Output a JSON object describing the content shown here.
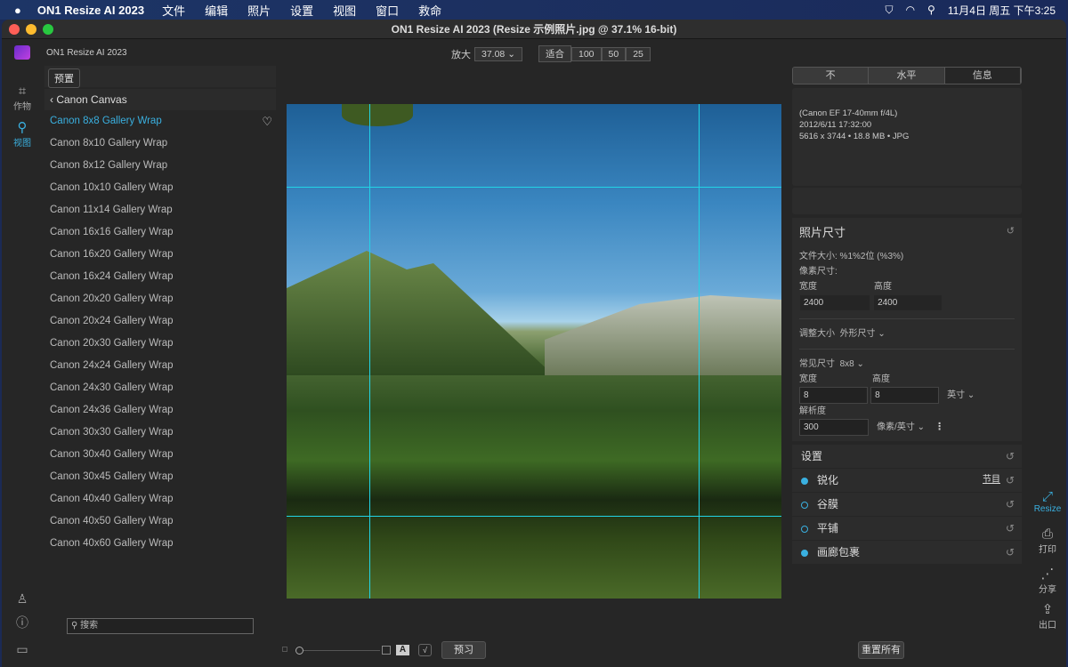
{
  "menubar": {
    "app": "ON1 Resize AI 2023",
    "items": [
      "文件",
      "编辑",
      "照片",
      "设置",
      "视图",
      "窗口",
      "救命"
    ],
    "clock": "11月4日 周五 下午3:25"
  },
  "window": {
    "title": "ON1 Resize AI 2023 (Resize 示例照片.jpg @ 37.1% 16-bit)",
    "app_label": "ON1 Resize AI 2023"
  },
  "leftbar": {
    "crop": "作物",
    "view": "视图"
  },
  "presets": {
    "button": "预置",
    "back": "Canon Canvas",
    "selected": 0,
    "items": [
      "Canon 8x8 Gallery Wrap",
      "Canon 8x10 Gallery Wrap",
      "Canon 8x12 Gallery Wrap",
      "Canon 10x10 Gallery Wrap",
      "Canon 11x14 Gallery Wrap",
      "Canon 16x16 Gallery Wrap",
      "Canon 16x20 Gallery Wrap",
      "Canon 16x24 Gallery Wrap",
      "Canon 20x20 Gallery Wrap",
      "Canon 20x24 Gallery Wrap",
      "Canon 20x30 Gallery Wrap",
      "Canon 24x24 Gallery Wrap",
      "Canon 24x30 Gallery Wrap",
      "Canon 24x36 Gallery Wrap",
      "Canon 30x30 Gallery Wrap",
      "Canon 30x40 Gallery Wrap",
      "Canon 30x45 Gallery Wrap",
      "Canon 40x40 Gallery Wrap",
      "Canon 40x50 Gallery Wrap",
      "Canon 40x60 Gallery Wrap"
    ],
    "search_placeholder": "搜索"
  },
  "zoom": {
    "label": "放大",
    "value": "37.08",
    "fit": "适合",
    "presets": [
      "100",
      "50",
      "25"
    ]
  },
  "tabs": {
    "items": [
      "不",
      "水平",
      "信息"
    ],
    "active": 2
  },
  "info": {
    "lens": "(Canon EF 17-40mm f/4L)",
    "date": "2012/6/11  17:32:00",
    "meta": "5616 x 3744 • 18.8 MB • JPG"
  },
  "size": {
    "title": "照片尺寸",
    "file_size": "文件大小: %1%2位 (%3%)",
    "pixel_dims": "像素尺寸:",
    "width_label": "宽度",
    "height_label": "高度",
    "px_width": "2400",
    "px_height": "2400",
    "resize_label": "调整大小",
    "resize_value": "外形尺寸",
    "common_label": "常见尺寸",
    "common_value": "8x8",
    "width": "8",
    "height": "8",
    "unit": "英寸",
    "res_label": "解析度",
    "res": "300",
    "res_unit": "像素/英寸"
  },
  "settings": {
    "title": "设置",
    "rows": [
      {
        "label": "锐化",
        "on": true,
        "extra": "节目"
      },
      {
        "label": "谷膜",
        "on": false
      },
      {
        "label": "平铺",
        "on": false
      },
      {
        "label": "画廊包裹",
        "on": true
      }
    ]
  },
  "righttools": {
    "resize": "Resize",
    "print": "打印",
    "share": "分享",
    "export": "出口"
  },
  "bottom": {
    "preview": "预习",
    "reset_all": "重置所有"
  },
  "colors": {
    "accent": "#3ab0e0",
    "guide": "#22d4e6"
  }
}
